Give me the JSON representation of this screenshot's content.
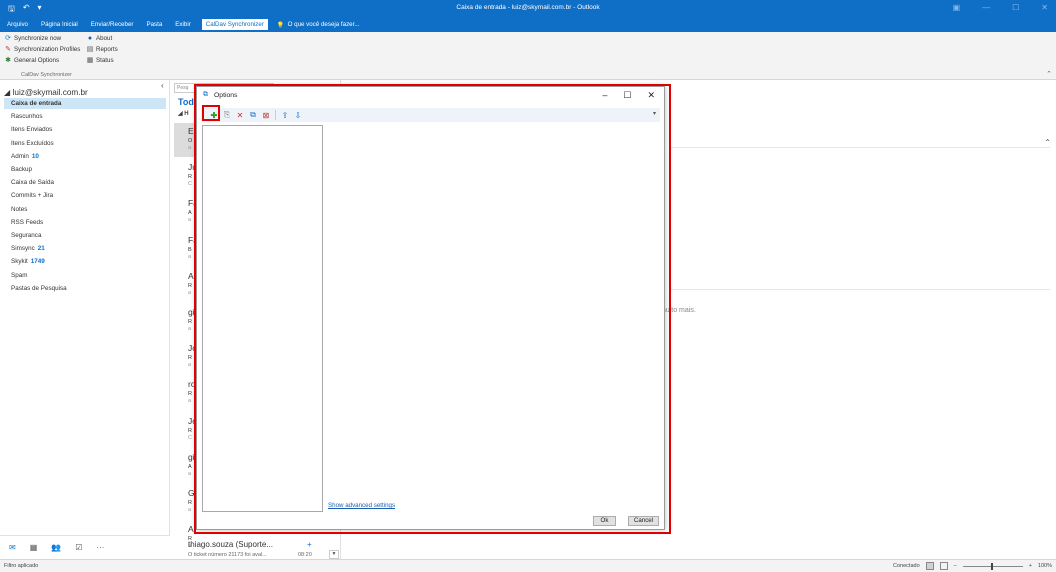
{
  "titlebar": {
    "title": "Caixa de entrada - luiz@skymail.com.br - Outlook"
  },
  "tabs": [
    {
      "label": "Arquivo"
    },
    {
      "label": "Página Inicial"
    },
    {
      "label": "Enviar/Receber"
    },
    {
      "label": "Pasta"
    },
    {
      "label": "Exibir"
    },
    {
      "label": "CalDav Synchronizer"
    }
  ],
  "tell_me": "O que você deseja fazer...",
  "ribbon": {
    "sync_now": "Synchronize now",
    "about": "About",
    "sync_profiles": "Synchronization Profiles",
    "reports": "Reports",
    "general_options": "General Options",
    "status": "Status",
    "group_label": "CalDav Synchronizer"
  },
  "folders": {
    "account": "luiz@skymail.com.br",
    "items": [
      {
        "name": "Caixa de entrada",
        "count": ""
      },
      {
        "name": "Rascunhos",
        "count": ""
      },
      {
        "name": "Itens Enviados",
        "count": ""
      },
      {
        "name": "Itens Excluídos",
        "count": ""
      },
      {
        "name": "Admin",
        "count": "10"
      },
      {
        "name": "Backup",
        "count": ""
      },
      {
        "name": "Caixa de Saída",
        "count": ""
      },
      {
        "name": "Commits + Jira",
        "count": ""
      },
      {
        "name": "Notes",
        "count": ""
      },
      {
        "name": "RSS Feeds",
        "count": ""
      },
      {
        "name": "Seguranca",
        "count": ""
      },
      {
        "name": "Simsync",
        "count": "21"
      },
      {
        "name": "Skykit",
        "count": "1749"
      },
      {
        "name": "Spam",
        "count": ""
      },
      {
        "name": "Pastas de Pesquisa",
        "count": ""
      }
    ]
  },
  "msglist": {
    "search_placeholder": "Pesq",
    "header": "Tod",
    "group": "H",
    "rows": [
      {
        "sender": "E",
        "subj": "O",
        "prev": "a"
      },
      {
        "sender": "Ju",
        "subj": "R",
        "prev": "C"
      },
      {
        "sender": "Fa",
        "subj": "A",
        "prev": "a"
      },
      {
        "sender": "Fa",
        "subj": "B",
        "prev": "a"
      },
      {
        "sender": "A",
        "subj": "R",
        "prev": "a"
      },
      {
        "sender": "gi",
        "subj": "R",
        "prev": "a"
      },
      {
        "sender": "Jo",
        "subj": "R",
        "prev": "a"
      },
      {
        "sender": "ro",
        "subj": "R",
        "prev": "a"
      },
      {
        "sender": "Jo",
        "subj": "R",
        "prev": "C"
      },
      {
        "sender": "gi",
        "subj": "A",
        "prev": "a"
      },
      {
        "sender": "G",
        "subj": "R",
        "prev": "a"
      },
      {
        "sender": "A",
        "subj": "R",
        "prev": "a"
      }
    ],
    "last": {
      "sender": "thiago.souza (Suporte...",
      "preview": "O ticket número 21173 foi aval...",
      "time": "08:20"
    }
  },
  "reading": {
    "more_text": "muito mais."
  },
  "dialog": {
    "title": "Options",
    "advanced_link": "Show advanced settings",
    "ok": "Ok",
    "cancel": "Cancel"
  },
  "statusbar": {
    "left": "Filtro aplicado",
    "connection": "Conectado",
    "zoom": "100%"
  },
  "colors": {
    "accent": "#0f6fc6",
    "highlight": "#e00000"
  }
}
